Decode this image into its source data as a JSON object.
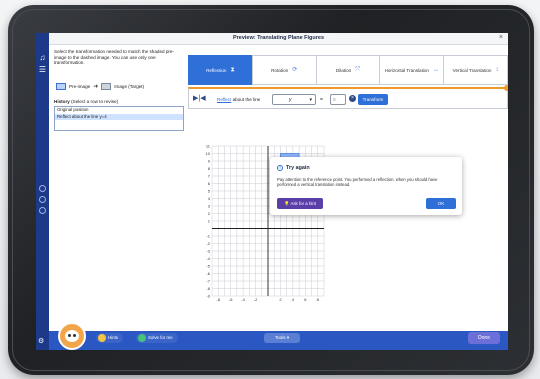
{
  "window": {
    "title": "Preview: Translating Plane Figures"
  },
  "instructions": "Select the transformation needed to match the shaded pre-image to the dashed image. You can use only one transformation.",
  "legend": {
    "pre_image": "Pre-image",
    "image": "Image (Target)"
  },
  "history": {
    "label_bold": "History",
    "label_rest": " (Select a row to revise)",
    "items": [
      "Original position",
      "Reflect about the line y=4"
    ]
  },
  "tabs": [
    {
      "label": "Reflection",
      "icon": "reflection-icon"
    },
    {
      "label": "Rotation",
      "icon": "rotation-icon"
    },
    {
      "label": "Dilation",
      "icon": "dilation-icon"
    },
    {
      "label": "Horizontal Translation",
      "icon": "horizontal-translation-icon"
    },
    {
      "label": "Vertical Translation",
      "icon": "vertical-translation-icon"
    }
  ],
  "reflect": {
    "link_text": "Reflect",
    "rest_text": " about the line",
    "variable": "y",
    "equals": "=",
    "value_placeholder": "0",
    "button": "Transform"
  },
  "graph": {
    "xmin": -9,
    "xmax": 9,
    "ymin": -9,
    "ymax": 11,
    "x_ticks": [
      "-8",
      "-6",
      "-4",
      "-2",
      "2",
      "4",
      "6",
      "8"
    ],
    "y_ticks": [
      "11",
      "10",
      "9",
      "8",
      "7",
      "6",
      "5",
      "4",
      "3",
      "2",
      "1",
      "-1",
      "-2",
      "-3",
      "-4",
      "-5",
      "-6",
      "-7",
      "-8",
      "-9"
    ],
    "highlight": {
      "x1": 2,
      "x2": 5,
      "y1": 9,
      "y2": 10
    },
    "colors": {
      "grid": "#c9cdd4",
      "axis": "#222222",
      "highlight": "#8fb6ff"
    }
  },
  "toast": {
    "title": "Try again",
    "body": "Pay attention to the reference point. You performed a reflection, when you should have performed a vertical translation instead.",
    "hint": "Ask for a hint",
    "ok": "OK"
  },
  "bottom": {
    "hints": "Hints",
    "solve": "Solve for me",
    "tools": "Tools",
    "done": "Done"
  },
  "colors": {
    "primary": "#2e6fd8",
    "navy": "#1d3a8a",
    "accent_orange": "#f09a2a",
    "hint_purple": "#5b3fa8"
  }
}
